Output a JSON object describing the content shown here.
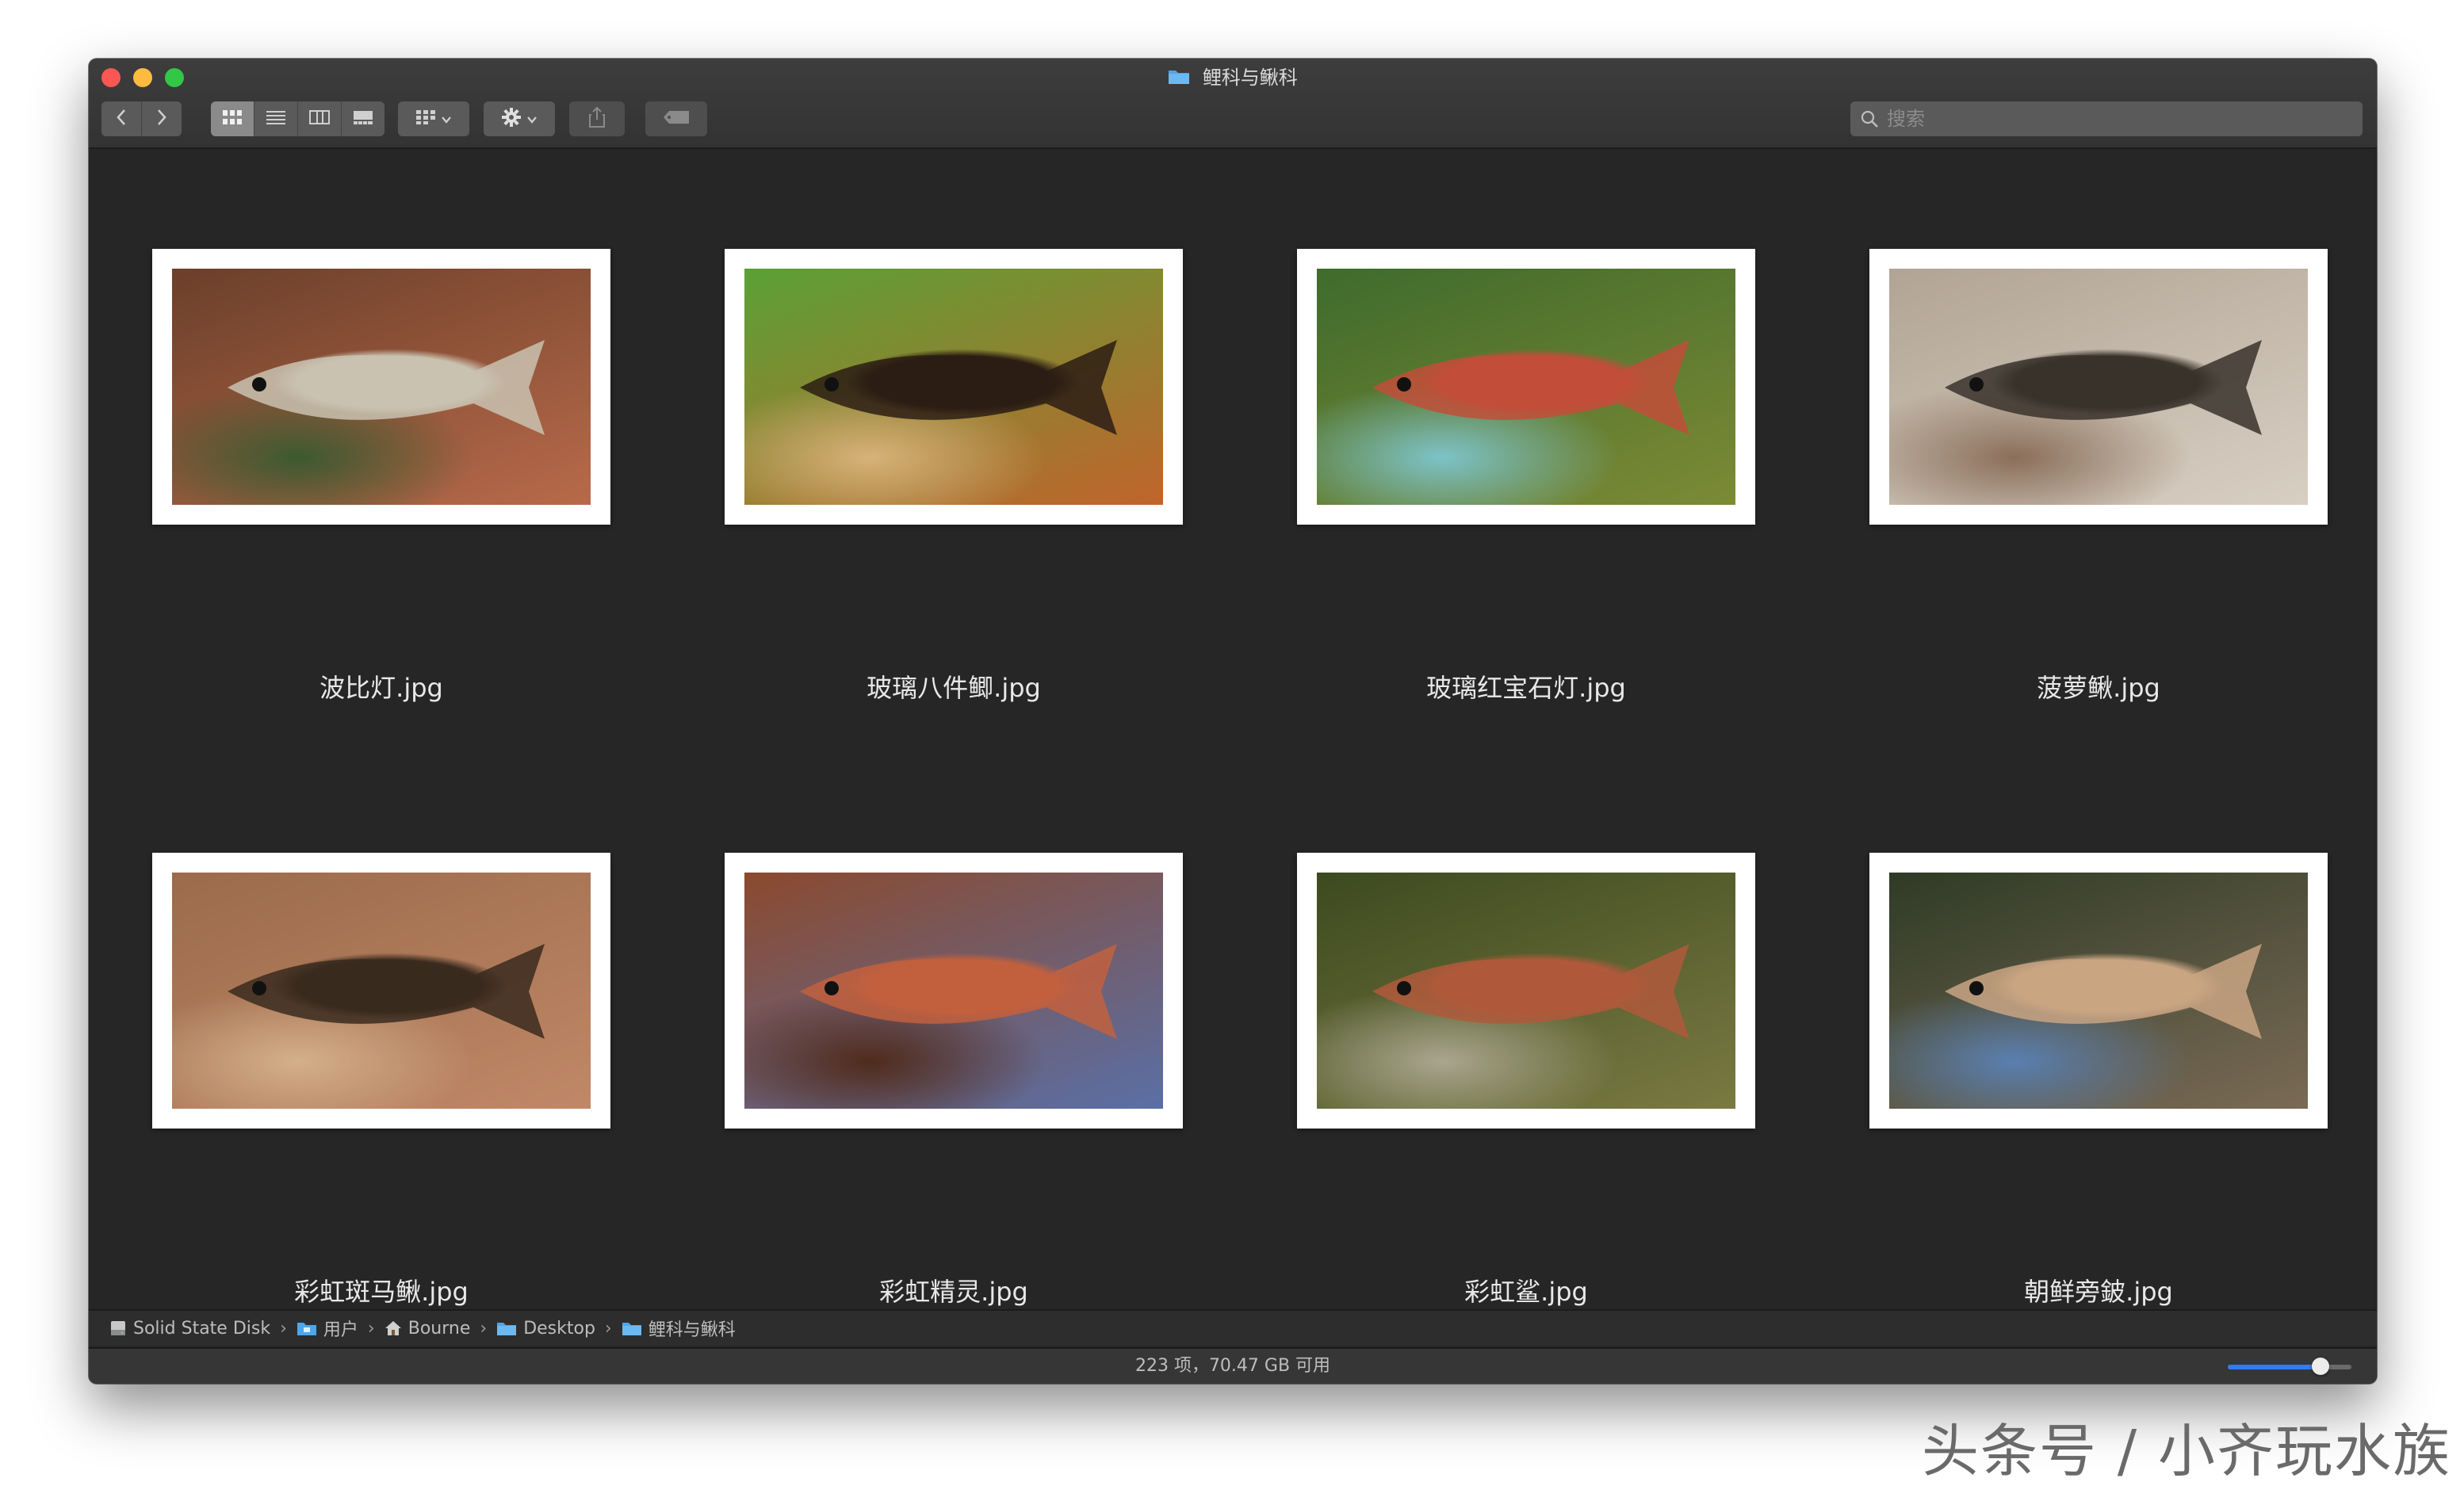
{
  "window": {
    "title": "鲤科与鳅科"
  },
  "toolbar": {
    "back_icon": "chevron-left-icon",
    "forward_icon": "chevron-right-icon",
    "view_modes": [
      "icon-view-icon",
      "list-view-icon",
      "column-view-icon",
      "gallery-view-icon"
    ],
    "active_view": "icon-view-icon",
    "group_icon": "grid-group-icon",
    "action_icon": "gear-icon",
    "share_icon": "share-icon",
    "tag_icon": "tag-icon",
    "search_placeholder": "搜索"
  },
  "files": [
    {
      "name": "波比灯.jpg",
      "palette": [
        "#6b3f2a",
        "#b86a4a",
        "#c9c2b0",
        "#3c5a2f"
      ]
    },
    {
      "name": "玻璃八件鲫.jpg",
      "palette": [
        "#5aa135",
        "#c1642c",
        "#2b1d14",
        "#d7b27a"
      ]
    },
    {
      "name": "玻璃红宝石灯.jpg",
      "palette": [
        "#3f6b2c",
        "#7c8a35",
        "#c24d3a",
        "#7dc3c8"
      ]
    },
    {
      "name": "菠萝鳅.jpg",
      "palette": [
        "#b1a494",
        "#d8cfc3",
        "#3a332c",
        "#8b6f5a"
      ]
    },
    {
      "name": "彩虹斑马鳅.jpg",
      "palette": [
        "#9b6b4b",
        "#c08867",
        "#3a2a1f",
        "#d3b08a"
      ]
    },
    {
      "name": "彩虹精灵.jpg",
      "palette": [
        "#8b4a2e",
        "#5a6fa6",
        "#c2603e",
        "#4f2b1c"
      ]
    },
    {
      "name": "彩虹鲨.jpg",
      "palette": [
        "#3d4a1f",
        "#7a7a42",
        "#b0593b",
        "#a9a58f"
      ]
    },
    {
      "name": "朝鲜旁鈹.jpg",
      "palette": [
        "#2f3b26",
        "#7a6a55",
        "#c9a583",
        "#5a7fb0"
      ]
    }
  ],
  "pathbar": {
    "crumbs": [
      {
        "label": "Solid State Disk",
        "icon": "disk-icon"
      },
      {
        "label": "用户",
        "icon": "users-folder-icon"
      },
      {
        "label": "Bourne",
        "icon": "home-icon"
      },
      {
        "label": "Desktop",
        "icon": "folder-icon"
      },
      {
        "label": "鲤科与鳅科",
        "icon": "folder-icon"
      }
    ],
    "separator": "›"
  },
  "status": {
    "text": "223 项，70.47 GB 可用",
    "icon_size_fraction": 0.75
  },
  "watermark": "头条号 / 小齐玩水族",
  "colors": {
    "window_bg": "#262626",
    "folder_blue": "#4fa6e8",
    "slider_accent": "#2f7cf6"
  }
}
